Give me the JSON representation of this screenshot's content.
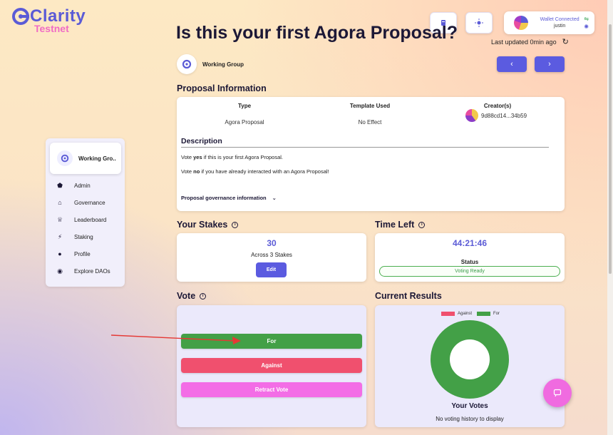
{
  "brand": {
    "name": "Clarity",
    "env": "Testnet",
    "accent": "#5b5bd6",
    "pink": "#f06bc5"
  },
  "header": {
    "title": "Is this your first Agora Proposal?",
    "last_updated": "Last updated 0min ago",
    "theme_icon": "sun-icon",
    "docs_icon": "book-icon"
  },
  "wallet": {
    "status": "Wallet Connected",
    "user": "justin"
  },
  "group": {
    "name": "Working Group"
  },
  "nav": {
    "prev": "‹",
    "next": "›"
  },
  "proposal_info": {
    "title": "Proposal Information",
    "columns": [
      {
        "header": "Type",
        "value": "Agora Proposal"
      },
      {
        "header": "Template Used",
        "value": "No Effect"
      },
      {
        "header": "Creator(s)",
        "value": "9d88cd14...34b59"
      }
    ],
    "description_title": "Description",
    "line1_a": "Vote ",
    "line1_b": "yes",
    "line1_c": " if this is your first Agora Proposal.",
    "line2_a": "Vote ",
    "line2_b": "no",
    "line2_c": " if you have already interacted with an Agora Proposal!",
    "governance_info": "Proposal governance information"
  },
  "sidebar": {
    "group_name": "Working Gro..",
    "items": [
      {
        "label": "Admin",
        "icon": "shield-icon"
      },
      {
        "label": "Governance",
        "icon": "bank-icon"
      },
      {
        "label": "Leaderboard",
        "icon": "trophy-icon"
      },
      {
        "label": "Staking",
        "icon": "bolt-icon"
      },
      {
        "label": "Profile",
        "icon": "user-icon"
      },
      {
        "label": "Explore DAOs",
        "icon": "compass-icon"
      }
    ]
  },
  "stakes": {
    "title": "Your Stakes",
    "amount": "30",
    "subtitle": "Across 3 Stakes",
    "edit": "Edit"
  },
  "time_left": {
    "title": "Time Left",
    "value": "44:21:46",
    "status_label": "Status",
    "status": "Voting Ready"
  },
  "vote": {
    "title": "Vote",
    "for": "For",
    "against": "Against",
    "retract": "Retract Vote",
    "colors": {
      "for": "#43a047",
      "against": "#f0506e",
      "retract": "#f36de6"
    }
  },
  "results": {
    "title": "Current Results",
    "legend": [
      {
        "name": "Against",
        "color": "#f0506e"
      },
      {
        "name": "For",
        "color": "#43a047"
      }
    ],
    "your_votes": "Your Votes",
    "no_history": "No voting history to display"
  }
}
